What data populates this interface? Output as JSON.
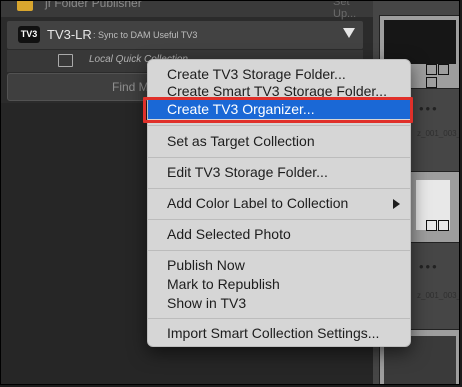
{
  "panel": {
    "top_label": "jf Folder Publisher",
    "top_right": "Set Up...",
    "service": {
      "logo": "TV3",
      "name": "TV3-LR",
      "desc": ": Sync to DAM Useful TV3"
    },
    "quick_collection": "Local Quick Collection",
    "find_label": "Find Missing Photos"
  },
  "filmstrip": {
    "file1": "z_001_003_0",
    "file2": "z_001_003_0"
  },
  "menu": {
    "items": [
      "Create TV3 Storage Folder...",
      "Create Smart TV3 Storage Folder...",
      "Create TV3 Organizer...",
      "Set as Target Collection",
      "Edit TV3 Storage Folder...",
      "Add Color Label to Collection",
      "Add Selected Photo",
      "Publish Now",
      "Mark to Republish",
      "Show in TV3",
      "Import Smart Collection Settings..."
    ],
    "selected_index": 2,
    "selection_color": "#1a68d6",
    "highlight_color": "#e0302a"
  }
}
